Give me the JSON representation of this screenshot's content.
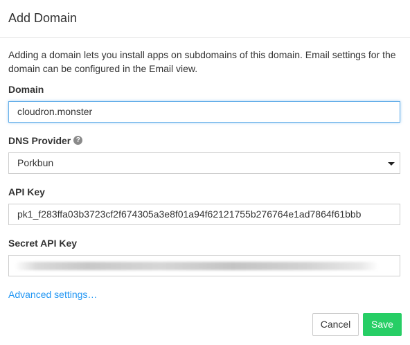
{
  "dialog": {
    "title": "Add Domain",
    "description": "Adding a domain lets you install apps on subdomains of this domain. Email settings for the domain can be configured in the Email view."
  },
  "form": {
    "domain_label": "Domain",
    "domain_value": "cloudron.monster",
    "dns_provider_label": "DNS Provider",
    "dns_provider_help_icon": "question-circle-icon",
    "dns_provider_value": "Porkbun",
    "api_key_label": "API Key",
    "api_key_value": "pk1_f283ffa03b3723cf2f674305a3e8f01a94f62121755b276764e1ad7864f61bbb",
    "secret_api_key_label": "Secret API Key",
    "secret_api_key_value": ""
  },
  "advanced_link": "Advanced settings…",
  "buttons": {
    "cancel": "Cancel",
    "save": "Save"
  },
  "colors": {
    "link": "#2196f3",
    "save_button": "#27ce65",
    "focus_border": "#66afe9"
  }
}
